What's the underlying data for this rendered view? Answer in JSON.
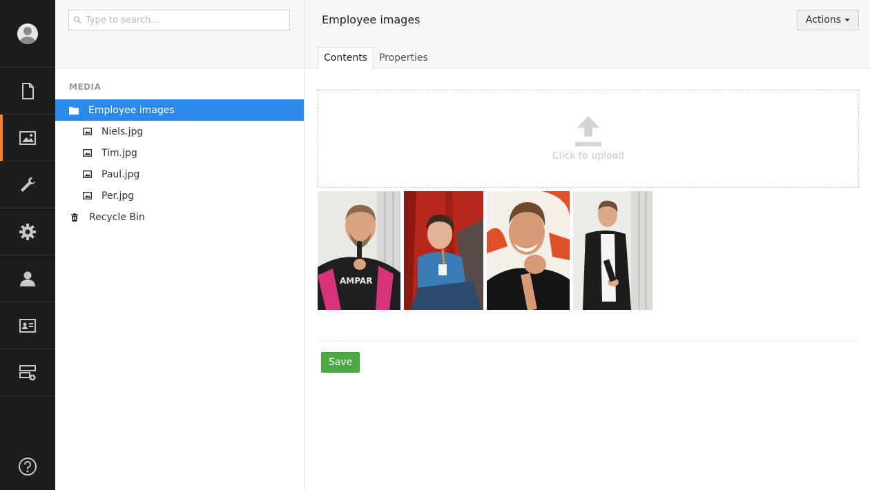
{
  "search": {
    "placeholder": "Type to search..."
  },
  "tree": {
    "title": "MEDIA",
    "root": "Employee images",
    "items": [
      {
        "label": "Niels.jpg"
      },
      {
        "label": "Tim.jpg"
      },
      {
        "label": "Paul.jpg"
      },
      {
        "label": "Per.jpg"
      }
    ],
    "recycle": "Recycle Bin"
  },
  "main": {
    "title": "Employee images",
    "actions_label": "Actions",
    "tabs": [
      {
        "label": "Contents"
      },
      {
        "label": "Properties"
      }
    ],
    "upload_label": "Click to upload",
    "save_label": "Save"
  },
  "colors": {
    "accent": "#f5813d",
    "selected": "#2e8aea",
    "save": "#4bab42",
    "sidebar": "#1d1d1d"
  },
  "sections": [
    "content-icon",
    "media-icon",
    "settings-wrench-icon",
    "developer-gear-icon",
    "users-icon",
    "members-icon",
    "forms-icon"
  ]
}
